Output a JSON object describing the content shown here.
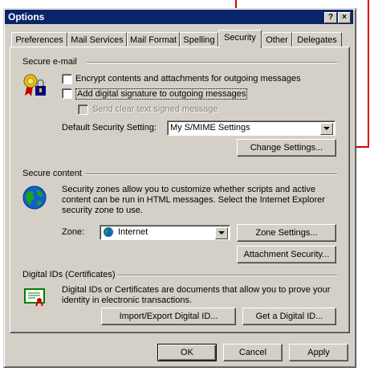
{
  "window": {
    "title": "Options",
    "help_label": "?",
    "close_label": "×"
  },
  "tabs": [
    {
      "label": "Preferences"
    },
    {
      "label": "Mail Services"
    },
    {
      "label": "Mail Format"
    },
    {
      "label": "Spelling"
    },
    {
      "label": "Security",
      "selected": true
    },
    {
      "label": "Other"
    },
    {
      "label": "Delegates"
    }
  ],
  "secure_email": {
    "header": "Secure e-mail",
    "encrypt_label": "Encrypt contents and attachments for outgoing messages",
    "sign_label": "Add digital signature to outgoing messages",
    "clear_text_label": "Send clear text signed message",
    "default_setting_label": "Default Security Setting:",
    "default_setting_value": "My S/MIME Settings",
    "change_settings_label": "Change Settings..."
  },
  "secure_content": {
    "header": "Secure content",
    "description": "Security zones allow you to customize whether scripts and active content can be run in HTML messages.  Select the Internet Explorer security zone to use.",
    "zone_label": "Zone:",
    "zone_value": "Internet",
    "zone_settings_label": "Zone Settings...",
    "attachment_security_label": "Attachment Security..."
  },
  "digital_ids": {
    "header": "Digital IDs (Certificates)",
    "description": "Digital IDs or Certificates are documents that allow you to prove your identity in electronic transactions.",
    "import_export_label": "Import/Export Digital ID...",
    "get_id_label": "Get a Digital ID..."
  },
  "footer": {
    "ok_label": "OK",
    "cancel_label": "Cancel",
    "apply_label": "Apply"
  },
  "annotation_color": "#dd0000"
}
